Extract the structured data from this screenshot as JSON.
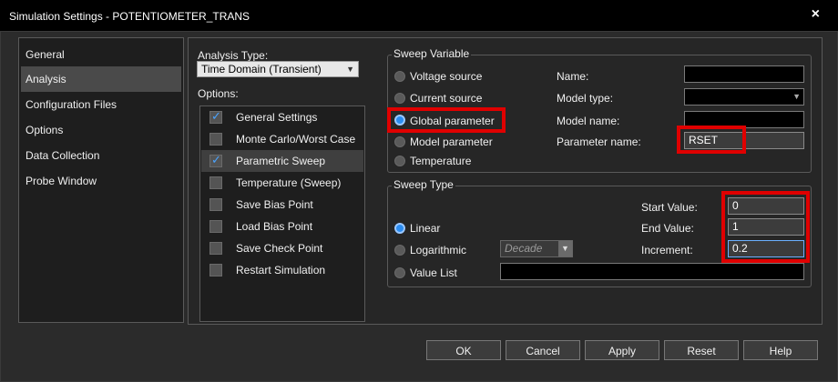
{
  "window": {
    "title": "Simulation Settings - POTENTIOMETER_TRANS",
    "close_glyph": "×"
  },
  "sidebar": {
    "items": [
      {
        "label": "General"
      },
      {
        "label": "Analysis"
      },
      {
        "label": "Configuration Files"
      },
      {
        "label": "Options"
      },
      {
        "label": "Data Collection"
      },
      {
        "label": "Probe Window"
      }
    ]
  },
  "analysis": {
    "type_label": "Analysis Type:",
    "type_value": "Time Domain (Transient)",
    "options_label": "Options:",
    "options": [
      {
        "label": "General Settings",
        "checked": true
      },
      {
        "label": "Monte Carlo/Worst Case",
        "checked": false
      },
      {
        "label": "Parametric Sweep",
        "checked": true
      },
      {
        "label": "Temperature (Sweep)",
        "checked": false
      },
      {
        "label": "Save Bias Point",
        "checked": false
      },
      {
        "label": "Load Bias Point",
        "checked": false
      },
      {
        "label": "Save Check Point",
        "checked": false
      },
      {
        "label": "Restart Simulation",
        "checked": false
      }
    ]
  },
  "sweep_variable": {
    "title": "Sweep Variable",
    "radios": [
      {
        "label": "Voltage source"
      },
      {
        "label": "Current source"
      },
      {
        "label": "Global parameter"
      },
      {
        "label": "Model parameter"
      },
      {
        "label": "Temperature"
      }
    ],
    "name_label": "Name:",
    "name_value": "",
    "model_type_label": "Model type:",
    "model_type_value": "",
    "model_name_label": "Model name:",
    "model_name_value": "",
    "param_name_label": "Parameter name:",
    "param_name_value": "RSET"
  },
  "sweep_type": {
    "title": "Sweep Type",
    "linear_label": "Linear",
    "log_label": "Logarithmic",
    "log_option": "Decade",
    "value_list_label": "Value List",
    "value_list_value": "",
    "start_label": "Start Value:",
    "start_value": "0",
    "end_label": "End Value:",
    "end_value": "1",
    "increment_label": "Increment:",
    "increment_value": "0.2"
  },
  "buttons": {
    "ok": "OK",
    "cancel": "Cancel",
    "apply": "Apply",
    "reset": "Reset",
    "help": "Help"
  },
  "colors": {
    "highlight": "#e00000",
    "radio_selected": "#2b8cf0",
    "check_accent": "#4aa3ff"
  }
}
